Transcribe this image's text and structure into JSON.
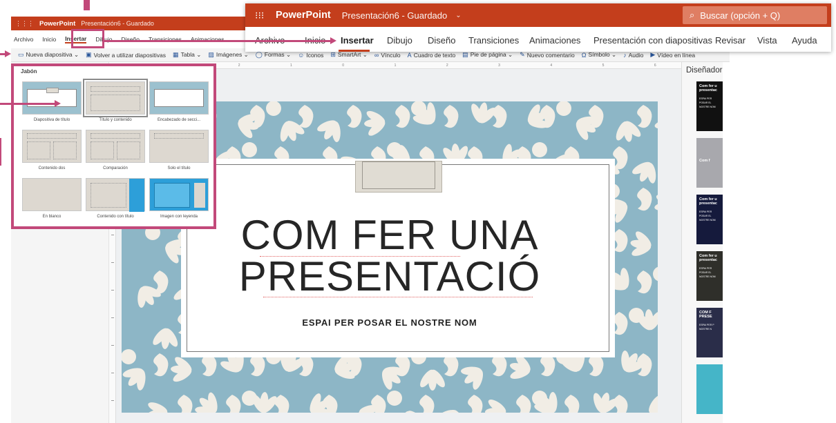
{
  "background_window": {
    "app_name": "PowerPoint",
    "doc_title": "Presentación6 - Guardado",
    "tabs": [
      {
        "label": "Archivo",
        "active": false
      },
      {
        "label": "Inicio",
        "active": false
      },
      {
        "label": "Insertar",
        "active": true
      },
      {
        "label": "Dibujo",
        "active": false
      },
      {
        "label": "Diseño",
        "active": false
      },
      {
        "label": "Transiciones",
        "active": false
      },
      {
        "label": "Animaciones",
        "active": false
      }
    ]
  },
  "toolbar": {
    "items": [
      {
        "label": "Nueva diapositiva ⌄",
        "icon": "new-slide-icon"
      },
      {
        "label": "Volver a utilizar diapositivas",
        "icon": "reuse-slides-icon"
      },
      {
        "label": "Tabla ⌄",
        "icon": "table-icon"
      },
      {
        "label": "Imágenes ⌄",
        "icon": "image-icon"
      },
      {
        "label": "Formas ⌄",
        "icon": "shapes-icon"
      },
      {
        "label": "Iconos",
        "icon": "icons-icon"
      },
      {
        "label": "SmartArt ⌄",
        "icon": "smartart-icon"
      },
      {
        "label": "Vínculo",
        "icon": "link-icon"
      },
      {
        "label": "Cuadro de texto",
        "icon": "textbox-icon"
      },
      {
        "label": "Pie de página ⌄",
        "icon": "footer-icon"
      },
      {
        "label": "Nuevo comentario",
        "icon": "comment-icon"
      },
      {
        "label": "Símbolo ⌄",
        "icon": "symbol-icon"
      },
      {
        "label": "Audio",
        "icon": "audio-icon"
      },
      {
        "label": "Vídeo en línea",
        "icon": "video-icon"
      }
    ]
  },
  "ribbon_zoom": {
    "app_name": "PowerPoint",
    "doc_title": "Presentación6 - Guardado",
    "search_placeholder": "Buscar (opción + Q)",
    "tabs": [
      {
        "label": "Archivo",
        "active": false
      },
      {
        "label": "Inicio",
        "active": false
      },
      {
        "label": "Insertar",
        "active": true
      },
      {
        "label": "Dibujo",
        "active": false
      },
      {
        "label": "Diseño",
        "active": false
      },
      {
        "label": "Transiciones",
        "active": false
      },
      {
        "label": "Animaciones",
        "active": false
      },
      {
        "label": "Presentación con diapositivas",
        "active": false
      },
      {
        "label": "Revisar",
        "active": false
      },
      {
        "label": "Vista",
        "active": false
      },
      {
        "label": "Ayuda",
        "active": false
      }
    ]
  },
  "layout_gallery": {
    "theme_name": "Jabón",
    "layouts": [
      {
        "name": "Diapositiva de título",
        "selected": false
      },
      {
        "name": "Título y contenido",
        "selected": true
      },
      {
        "name": "Encabezado de secci...",
        "selected": false
      },
      {
        "name": "Contenido dos",
        "selected": false
      },
      {
        "name": "Comparación",
        "selected": false
      },
      {
        "name": "Solo el título",
        "selected": false
      },
      {
        "name": "En blanco",
        "selected": false
      },
      {
        "name": "Contenido con título",
        "selected": false
      },
      {
        "name": "Imagen con leyenda",
        "selected": false
      }
    ]
  },
  "slide": {
    "title_line1": "COM FER UNA",
    "title_line2": "PRESENTACIÓ",
    "subtitle": "ESPAI PER POSAR EL NOSTRE NOM",
    "background_color": "#8db6c6",
    "pattern_color": "#f1ede5"
  },
  "designer": {
    "title": "Diseñador",
    "thumbnails": [
      {
        "title": "Com fer u presentac",
        "subtitle": "ESPAI PER POSAR EL NOSTRE NOM",
        "bg": "#111111"
      },
      {
        "title": "Com f",
        "subtitle": "",
        "bg": "#a8a8ad"
      },
      {
        "title": "Com fer u presentac",
        "subtitle": "ESPAI PER POSAR EL NOSTRE NOM",
        "bg": "#151a3c"
      },
      {
        "title": "Com fer u presentac",
        "subtitle": "ESPAI PER POSAR EL NOSTRE NOM",
        "bg": "#2f2f2a"
      },
      {
        "title": "COM F PRESE",
        "subtitle": "ESPAI PER P NOSTRE N",
        "bg": "#2a2d49"
      },
      {
        "title": "",
        "subtitle": "",
        "bg": "#45b5c8"
      }
    ]
  },
  "colors": {
    "brand": "#c43e1c",
    "highlight": "#c2497a"
  }
}
